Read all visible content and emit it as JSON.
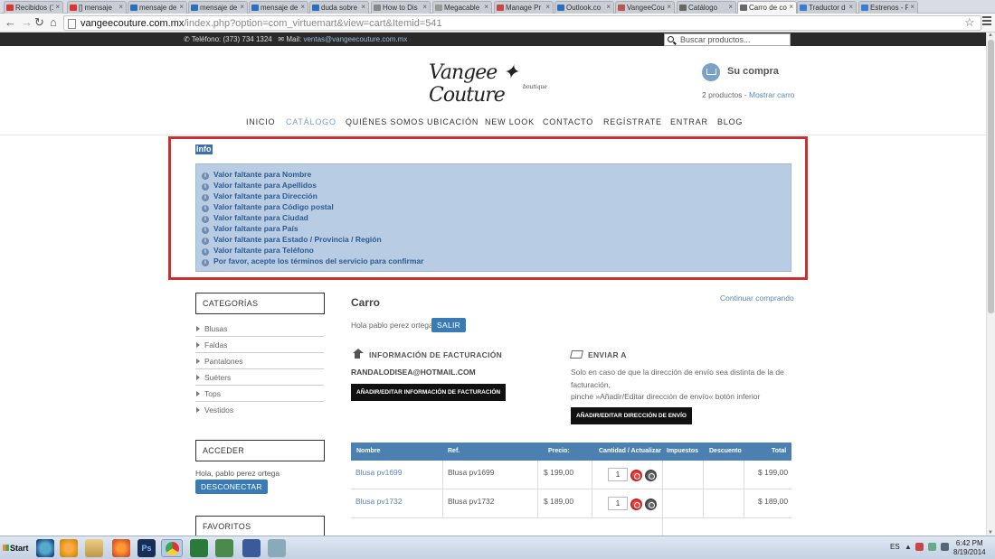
{
  "browser": {
    "tabs": [
      {
        "label": "Recibidos (1",
        "color": "#d33"
      },
      {
        "label": "[] mensaje",
        "color": "#d33"
      },
      {
        "label": "mensaje de",
        "color": "#2a6fbf"
      },
      {
        "label": "mensaje de",
        "color": "#2a6fbf"
      },
      {
        "label": "mensaje de",
        "color": "#2a6fbf"
      },
      {
        "label": "duda sobre",
        "color": "#2a6fbf"
      },
      {
        "label": "How to Dis",
        "color": "#888"
      },
      {
        "label": "Megacable",
        "color": "#999"
      },
      {
        "label": "Manage Pr",
        "color": "#c44"
      },
      {
        "label": "Outlook.co",
        "color": "#2a6fbf"
      },
      {
        "label": "VangeeCou",
        "color": "#b55"
      },
      {
        "label": "Catálogo",
        "color": "#666"
      },
      {
        "label": "Carro de co",
        "color": "#666"
      },
      {
        "label": "Traductor d",
        "color": "#3a7bd5"
      },
      {
        "label": "Estrenos - P",
        "color": "#3a7bd5"
      }
    ],
    "url_host": "vangeecouture.com.mx",
    "url_path": "/index.php?option=com_virtuemart&view=cart&Itemid=541"
  },
  "topbar": {
    "phone_label": "Teléfono:",
    "phone": "(373) 734 1324",
    "mail_label": "Mail:",
    "mail": "ventas@vangeecouture.com.mx",
    "search_placeholder": "Buscar productos..."
  },
  "logo": {
    "name": "Vangee ✦ Couture",
    "tagline": "boutique"
  },
  "cart": {
    "title": "Su compra",
    "count": "2 productos",
    "sep": " - ",
    "show": "Mostrar carro"
  },
  "nav": [
    "INICIO",
    "CATÁLOGO",
    "QUIÉNES SOMOS",
    "UBICACIÓN",
    "NEW LOOK",
    "CONTACTO",
    "REGÍSTRATE",
    "ENTRAR",
    "BLOG"
  ],
  "info": {
    "title": "Info",
    "messages": [
      "Valor faltante para Nombre",
      "Valor faltante para Apellidos",
      "Valor faltante para Dirección",
      "Valor faltante para Código postal",
      "Valor faltante para Ciudad",
      "Valor faltante para País",
      "Valor faltante para Estado / Provincia / Región",
      "Valor faltante para Teléfono",
      "Por favor, acepte los términos del servicio para confirmar"
    ]
  },
  "sidebar": {
    "categories_title": "CATEGORÍAS",
    "categories": [
      "Blusas",
      "Faldas",
      "Pantalones",
      "Suéters",
      "Tops",
      "Vestidos"
    ],
    "login_title": "ACCEDER",
    "greeting": "Hola, pablo perez ortega",
    "logout": "DESCONECTAR",
    "favorites_title": "FAVORITOS"
  },
  "main": {
    "title": "Carro",
    "continue": "Continuar comprando",
    "greeting": "Hola pablo perez ortega",
    "exit": "SALIR",
    "billing_title": "INFORMACIÓN DE FACTURACIÓN",
    "email": "RANDALODISEA@HOTMAIL.COM",
    "billing_button": "AÑADIR/EDITAR INFORMACIÓN DE FACTURACIÓN",
    "shipping_title": "ENVIAR A",
    "shipping_text1": "Solo en caso de que la dirección de envío sea distinta de la de",
    "shipping_text2": "facturación,",
    "shipping_text3": "pinche »Añadir/Editar dirección de envío« botón inferior",
    "shipping_button": "AÑADIR/EDITAR DIRECCIÓN DE ENVÍO"
  },
  "table": {
    "headers": [
      "Nombre",
      "Ref.",
      "Precio:",
      "Cantidad / Actualizar",
      "Impuestos",
      "Descuento",
      "Total"
    ],
    "rows": [
      {
        "name": "Blusa pv1699",
        "ref": "Blusa pv1699",
        "price": "$ 199,00",
        "qty": "1",
        "total": "$ 199,00"
      },
      {
        "name": "Blusa pv1732",
        "ref": "Blusa pv1732",
        "price": "$ 189,00",
        "qty": "1",
        "total": "$ 189,00"
      }
    ]
  },
  "taskbar": {
    "start": "Start",
    "lang": "ES",
    "time": "6:42 PM",
    "date": "8/19/2014"
  }
}
